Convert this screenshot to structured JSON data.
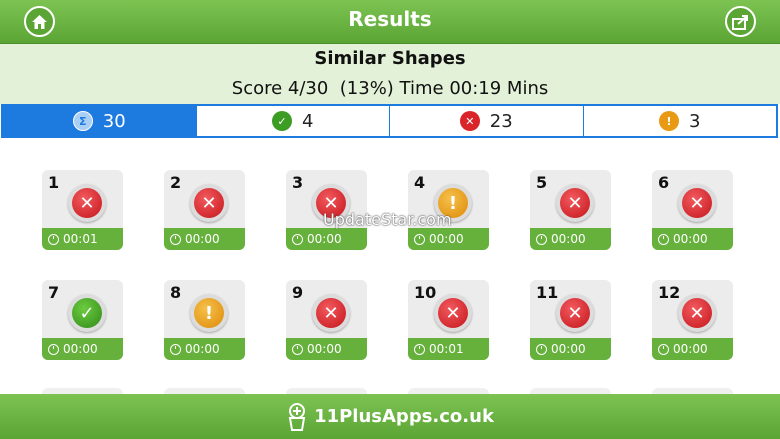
{
  "header": {
    "title": "Results",
    "home_icon": "home-icon",
    "share_icon": "share-icon"
  },
  "summary": {
    "quiz_name": "Similar Shapes",
    "score_line": "Score 4/30  (13%) Time 00:19 Mins"
  },
  "tabs": [
    {
      "count": "30",
      "icon": "sigma-icon",
      "glyph": "Σ"
    },
    {
      "count": "4",
      "icon": "check-icon",
      "glyph": "✓"
    },
    {
      "count": "23",
      "icon": "cross-icon",
      "glyph": "✕"
    },
    {
      "count": "3",
      "icon": "warning-icon",
      "glyph": "!"
    }
  ],
  "questions": [
    {
      "num": "1",
      "status": "wrong",
      "time": "00:01"
    },
    {
      "num": "2",
      "status": "wrong",
      "time": "00:00"
    },
    {
      "num": "3",
      "status": "wrong",
      "time": "00:00"
    },
    {
      "num": "4",
      "status": "warn",
      "time": "00:00"
    },
    {
      "num": "5",
      "status": "wrong",
      "time": "00:00"
    },
    {
      "num": "6",
      "status": "wrong",
      "time": "00:00"
    },
    {
      "num": "7",
      "status": "correct",
      "time": "00:00"
    },
    {
      "num": "8",
      "status": "warn",
      "time": "00:00"
    },
    {
      "num": "9",
      "status": "wrong",
      "time": "00:00"
    },
    {
      "num": "10",
      "status": "wrong",
      "time": "00:01"
    },
    {
      "num": "11",
      "status": "wrong",
      "time": "00:00"
    },
    {
      "num": "12",
      "status": "wrong",
      "time": "00:00"
    }
  ],
  "watermark": "UpdateStar.com",
  "footer": {
    "brand": "11PlusApps.co.uk"
  },
  "colors": {
    "green": "#66b13b",
    "blue": "#1d7be0",
    "red": "#d9252a",
    "orange": "#e89a14"
  }
}
